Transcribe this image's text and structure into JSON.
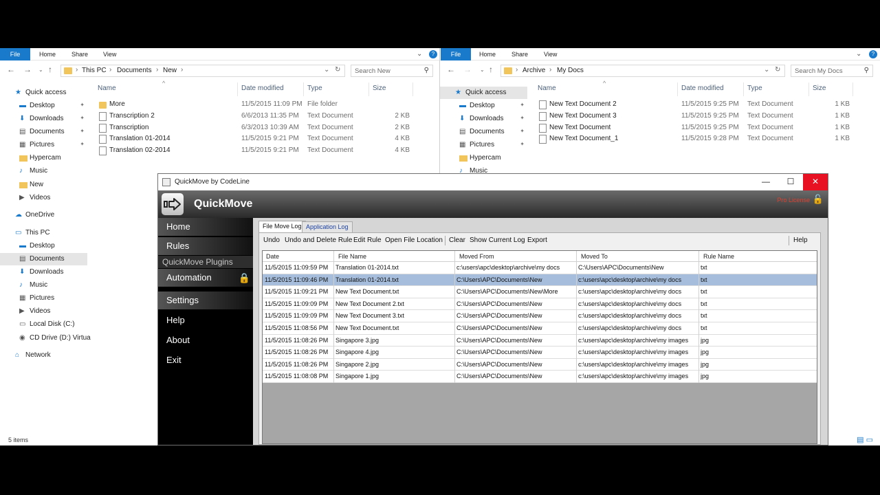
{
  "left_explorer": {
    "ribbon": {
      "file": "File",
      "home": "Home",
      "share": "Share",
      "view": "View"
    },
    "breadcrumb": [
      "This PC",
      "Documents",
      "New"
    ],
    "search_placeholder": "Search New",
    "nav": [
      {
        "label": "Quick access",
        "icon": "star-icon"
      },
      {
        "label": "Desktop",
        "icon": "desktop-icon",
        "pinned": true
      },
      {
        "label": "Downloads",
        "icon": "download-icon",
        "pinned": true
      },
      {
        "label": "Documents",
        "icon": "documents-icon",
        "pinned": true
      },
      {
        "label": "Pictures",
        "icon": "pictures-icon",
        "pinned": true
      },
      {
        "label": "Hypercam",
        "icon": "folder-icon"
      },
      {
        "label": "Music",
        "icon": "music-icon"
      },
      {
        "label": "New",
        "icon": "folder-icon"
      },
      {
        "label": "Videos",
        "icon": "videos-icon"
      },
      {
        "label": "OneDrive",
        "icon": "cloud-icon"
      },
      {
        "label": "This PC",
        "icon": "computer-icon"
      },
      {
        "label": "Desktop",
        "icon": "desktop-icon"
      },
      {
        "label": "Documents",
        "icon": "documents-icon",
        "selected": true
      },
      {
        "label": "Downloads",
        "icon": "download-icon"
      },
      {
        "label": "Music",
        "icon": "music-icon"
      },
      {
        "label": "Pictures",
        "icon": "pictures-icon"
      },
      {
        "label": "Videos",
        "icon": "videos-icon"
      },
      {
        "label": "Local Disk (C:)",
        "icon": "disk-icon"
      },
      {
        "label": "CD Drive (D:) Virtua",
        "icon": "cd-icon"
      },
      {
        "label": "Network",
        "icon": "network-icon"
      }
    ],
    "columns": [
      "Name",
      "Date modified",
      "Type",
      "Size"
    ],
    "files": [
      {
        "name": "More",
        "date": "11/5/2015 11:09 PM",
        "type": "File folder",
        "size": "",
        "kind": "folder"
      },
      {
        "name": "Transcription 2",
        "date": "6/6/2013 11:35 PM",
        "type": "Text Document",
        "size": "2 KB",
        "kind": "doc"
      },
      {
        "name": "Transcription",
        "date": "6/3/2013 10:39 AM",
        "type": "Text Document",
        "size": "2 KB",
        "kind": "doc"
      },
      {
        "name": "Translation 01-2014",
        "date": "11/5/2015 9:21 PM",
        "type": "Text Document",
        "size": "4 KB",
        "kind": "doc"
      },
      {
        "name": "Translation 02-2014",
        "date": "11/5/2015 9:21 PM",
        "type": "Text Document",
        "size": "4 KB",
        "kind": "doc"
      }
    ],
    "status": "5 items"
  },
  "right_explorer": {
    "ribbon": {
      "file": "File",
      "home": "Home",
      "share": "Share",
      "view": "View"
    },
    "breadcrumb": [
      "Archive",
      "My Docs"
    ],
    "search_placeholder": "Search My Docs",
    "nav": [
      {
        "label": "Quick access",
        "icon": "star-icon",
        "selected": true
      },
      {
        "label": "Desktop",
        "icon": "desktop-icon",
        "pinned": true
      },
      {
        "label": "Downloads",
        "icon": "download-icon",
        "pinned": true
      },
      {
        "label": "Documents",
        "icon": "documents-icon",
        "pinned": true
      },
      {
        "label": "Pictures",
        "icon": "pictures-icon",
        "pinned": true
      },
      {
        "label": "Hypercam",
        "icon": "folder-icon"
      },
      {
        "label": "Music",
        "icon": "music-icon"
      }
    ],
    "columns": [
      "Name",
      "Date modified",
      "Type",
      "Size"
    ],
    "files": [
      {
        "name": "New Text Document 2",
        "date": "11/5/2015 9:25 PM",
        "type": "Text Document",
        "size": "1 KB",
        "kind": "doc"
      },
      {
        "name": "New Text Document 3",
        "date": "11/5/2015 9:25 PM",
        "type": "Text Document",
        "size": "1 KB",
        "kind": "doc"
      },
      {
        "name": "New Text Document",
        "date": "11/5/2015 9:25 PM",
        "type": "Text Document",
        "size": "1 KB",
        "kind": "doc"
      },
      {
        "name": "New Text Document_1",
        "date": "11/5/2015 9:28 PM",
        "type": "Text Document",
        "size": "1 KB",
        "kind": "doc"
      }
    ]
  },
  "quickmove": {
    "window_title": "QuickMove by CodeLine",
    "brand": "QuickMove",
    "pro_license": "Pro License",
    "menu": {
      "home": "Home",
      "rules": "Rules",
      "plugins": "QuickMove Plugins",
      "automation": "Automation",
      "settings": "Settings",
      "help": "Help",
      "about": "About",
      "exit": "Exit"
    },
    "tabs": {
      "file_move_log": "File Move Log",
      "application_log": "Application Log"
    },
    "toolbar": {
      "undo": "Undo",
      "undo_delete_rule": "Undo and Delete Rule",
      "edit_rule": "Edit Rule",
      "open_file_location": "Open File Location",
      "clear": "Clear",
      "show_current_log": "Show Current Log",
      "export": "Export",
      "help": "Help"
    },
    "grid_columns": [
      "Date",
      "File Name",
      "Moved From",
      "Moved To",
      "Rule Name"
    ],
    "rows": [
      [
        "11/5/2015 11:09:59 PM",
        "Translation 01-2014.txt",
        "c:\\users\\apc\\desktop\\archive\\my docs",
        "C:\\Users\\APC\\Documents\\New",
        "txt"
      ],
      [
        "11/5/2015 11:09:46 PM",
        "Translation 01-2014.txt",
        "C:\\Users\\APC\\Documents\\New",
        "c:\\users\\apc\\desktop\\archive\\my docs",
        "txt"
      ],
      [
        "11/5/2015 11:09:21 PM",
        "New Text Document.txt",
        "C:\\Users\\APC\\Documents\\New\\More",
        "c:\\users\\apc\\desktop\\archive\\my docs",
        "txt"
      ],
      [
        "11/5/2015 11:09:09 PM",
        "New Text Document 2.txt",
        "C:\\Users\\APC\\Documents\\New",
        "c:\\users\\apc\\desktop\\archive\\my docs",
        "txt"
      ],
      [
        "11/5/2015 11:09:09 PM",
        "New Text Document 3.txt",
        "C:\\Users\\APC\\Documents\\New",
        "c:\\users\\apc\\desktop\\archive\\my docs",
        "txt"
      ],
      [
        "11/5/2015 11:08:56 PM",
        "New Text Document.txt",
        "C:\\Users\\APC\\Documents\\New",
        "c:\\users\\apc\\desktop\\archive\\my docs",
        "txt"
      ],
      [
        "11/5/2015 11:08:26 PM",
        "Singapore 3.jpg",
        "C:\\Users\\APC\\Documents\\New",
        "c:\\users\\apc\\desktop\\archive\\my images",
        "jpg"
      ],
      [
        "11/5/2015 11:08:26 PM",
        "Singapore 4.jpg",
        "C:\\Users\\APC\\Documents\\New",
        "c:\\users\\apc\\desktop\\archive\\my images",
        "jpg"
      ],
      [
        "11/5/2015 11:08:26 PM",
        "Singapore 2.jpg",
        "C:\\Users\\APC\\Documents\\New",
        "c:\\users\\apc\\desktop\\archive\\my images",
        "jpg"
      ],
      [
        "11/5/2015 11:08:08 PM",
        "Singapore 1.jpg",
        "C:\\Users\\APC\\Documents\\New",
        "c:\\users\\apc\\desktop\\archive\\my images",
        "jpg"
      ]
    ],
    "selected_row": 1
  },
  "colors": {
    "accent": "#1979ca",
    "close": "#e81123",
    "selection": "#a6bedc",
    "license": "#e04030"
  }
}
